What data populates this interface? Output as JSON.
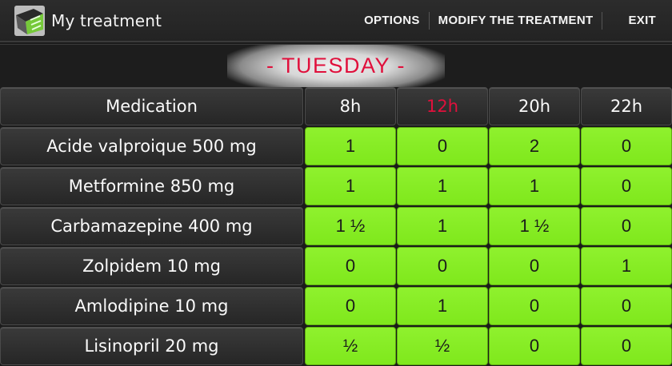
{
  "actionbar": {
    "title": "My treatment",
    "actions": [
      "OPTIONS",
      "MODIFY THE TREATMENT",
      "EXIT"
    ]
  },
  "day": "-  TUESDAY -",
  "table": {
    "header": [
      "Medication",
      "8h",
      "12h",
      "20h",
      "22h"
    ],
    "current_hour_index": 1,
    "rows": [
      {
        "name": "Acide valproique 500 mg",
        "doses": [
          "1",
          "0",
          "2",
          "0"
        ]
      },
      {
        "name": "Metformine 850 mg",
        "doses": [
          "1",
          "1",
          "1",
          "0"
        ]
      },
      {
        "name": "Carbamazepine 400 mg",
        "doses": [
          "1 ½",
          "1",
          "1 ½",
          "0"
        ]
      },
      {
        "name": "Zolpidem 10 mg",
        "doses": [
          "0",
          "0",
          "0",
          "1"
        ]
      },
      {
        "name": "Amlodipine 10 mg",
        "doses": [
          "0",
          "1",
          "0",
          "0"
        ]
      },
      {
        "name": "Lisinopril 20 mg",
        "doses": [
          "½",
          "½",
          "0",
          "0"
        ]
      }
    ]
  },
  "colors": {
    "accent_red": "#e0103c",
    "dose_green": "#85ee22"
  },
  "icons": {
    "app": "pill-box-icon"
  }
}
